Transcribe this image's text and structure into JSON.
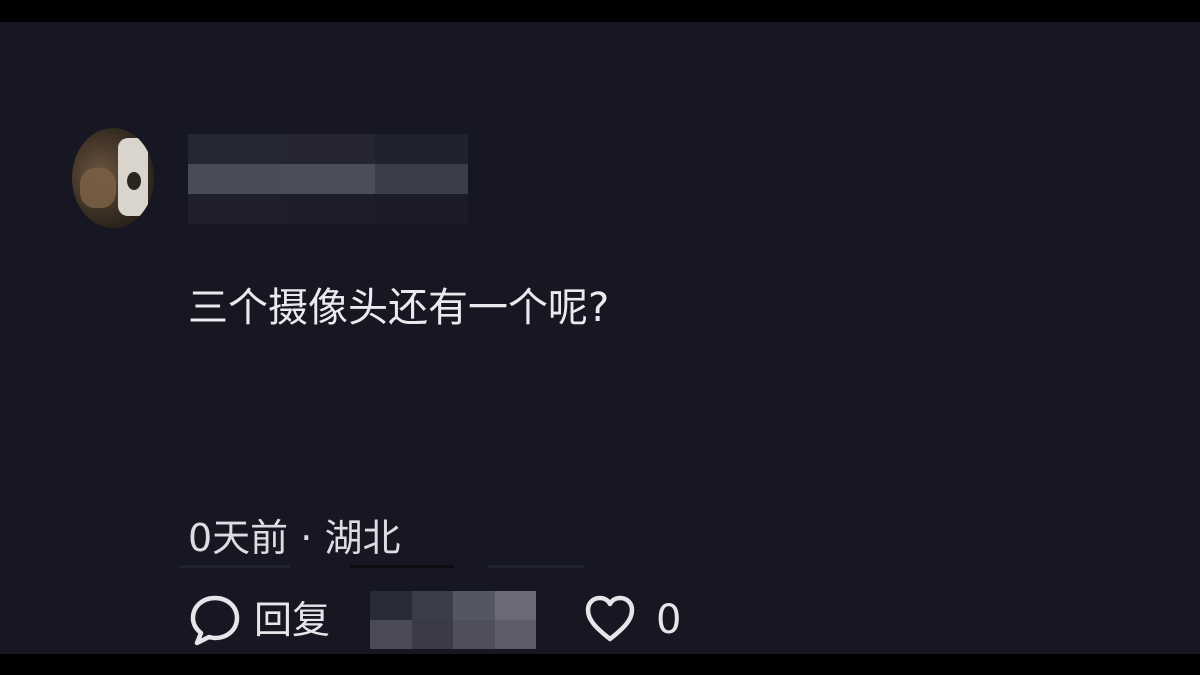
{
  "comment": {
    "text": "三个摄像头还有一个呢?",
    "time": "0天前",
    "separator": "·",
    "location": "湖北"
  },
  "actions": {
    "reply_icon": "speech-bubble-icon",
    "reply_label": "回复",
    "like_icon": "heart-outline-icon",
    "like_count": "0"
  },
  "colors": {
    "background": "#161722",
    "text": "#e9e9ee",
    "frame": "#000000"
  }
}
